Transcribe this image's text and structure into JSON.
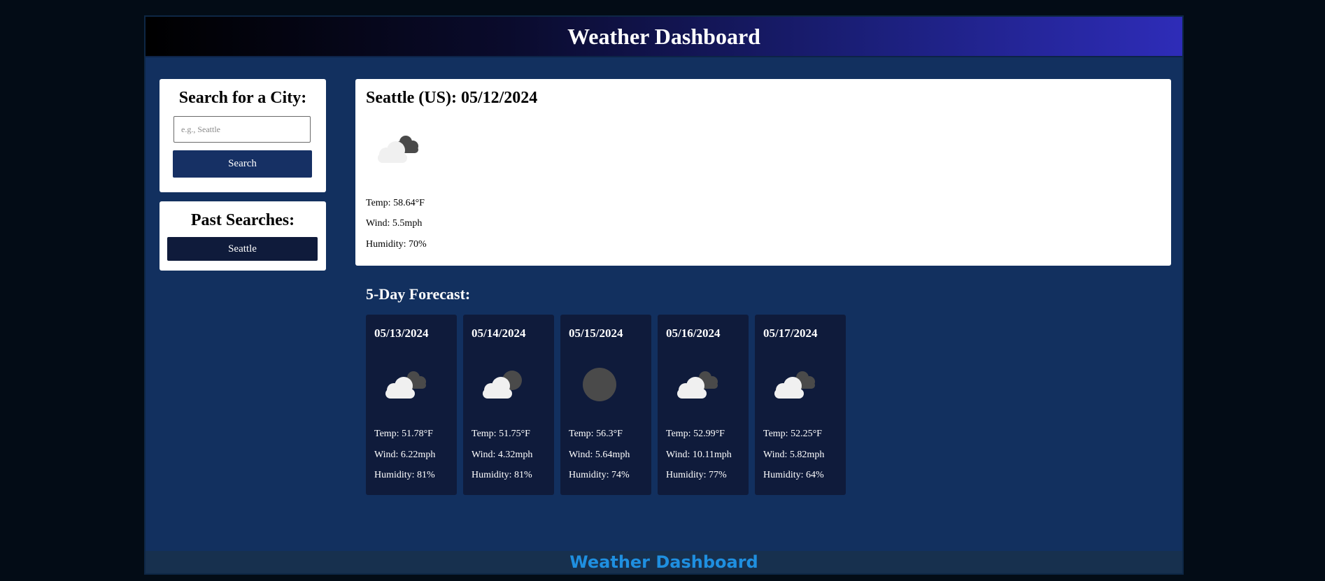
{
  "header": {
    "title": "Weather Dashboard"
  },
  "search": {
    "title": "Search for a City:",
    "placeholder": "e.g., Seattle",
    "button_label": "Search"
  },
  "past": {
    "title": "Past Searches:",
    "items": [
      {
        "label": "Seattle"
      }
    ]
  },
  "current": {
    "title": "Seattle (US): 05/12/2024",
    "icon": "broken-clouds-icon",
    "temp": "Temp: 58.64°F",
    "wind": "Wind: 5.5mph",
    "humidity": "Humidity: 70%"
  },
  "forecast": {
    "title": "5-Day Forecast:",
    "days": [
      {
        "date": "05/13/2024",
        "icon": "broken-clouds-icon",
        "temp": "Temp: 51.78°F",
        "wind": "Wind: 6.22mph",
        "humidity": "Humidity: 81%"
      },
      {
        "date": "05/14/2024",
        "icon": "overcast-clouds-icon",
        "temp": "Temp: 51.75°F",
        "wind": "Wind: 4.32mph",
        "humidity": "Humidity: 81%"
      },
      {
        "date": "05/15/2024",
        "icon": "dark-cloud-icon",
        "temp": "Temp: 56.3°F",
        "wind": "Wind: 5.64mph",
        "humidity": "Humidity: 74%"
      },
      {
        "date": "05/16/2024",
        "icon": "broken-clouds-icon",
        "temp": "Temp: 52.99°F",
        "wind": "Wind: 10.11mph",
        "humidity": "Humidity: 77%"
      },
      {
        "date": "05/17/2024",
        "icon": "broken-clouds-icon",
        "temp": "Temp: 52.25°F",
        "wind": "Wind: 5.82mph",
        "humidity": "Humidity: 64%"
      }
    ]
  },
  "footer": {
    "text": "Weather Dashboard"
  },
  "colors": {
    "background": "#030c16",
    "app_bg": "#12305f",
    "card_dark": "#0f1b3b",
    "button_blue": "#163064",
    "footer_text": "#1f8fe0"
  }
}
